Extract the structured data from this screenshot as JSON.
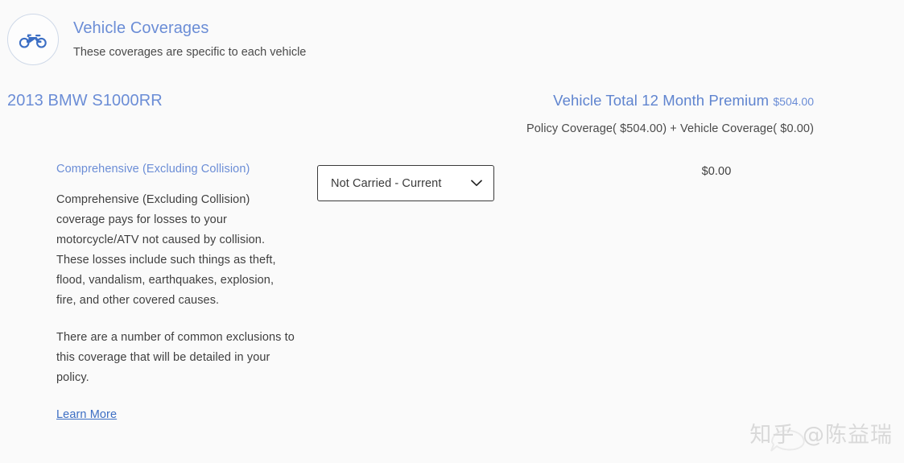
{
  "header": {
    "icon": "motorcycle-icon",
    "title": "Vehicle Coverages",
    "subtitle": "These coverages are specific to each vehicle",
    "accent_color": "#6b8dd6"
  },
  "vehicle": {
    "name": "2013 BMW S1000RR",
    "premium_label": "Vehicle Total 12 Month Premium",
    "premium_amount": "$504.00",
    "premium_breakdown": "Policy Coverage( $504.00) + Vehicle Coverage( $0.00)"
  },
  "coverage": {
    "name": "Comprehensive (Excluding Collision)",
    "description_1": "Comprehensive (Excluding Collision) coverage pays for losses to your motorcycle/ATV not caused by collision. These losses include such things as theft, flood, vandalism, earthquakes, explosion, fire, and other covered causes.",
    "description_2": "There are a number of common exclusions to this coverage that will be detailed in your policy.",
    "learn_more": "Learn More",
    "selected_option": "Not Carried - Current",
    "dropdown_icon": "chevron-down-icon",
    "price": "$0.00"
  },
  "watermark": {
    "text": "知乎 @陈益瑞"
  }
}
